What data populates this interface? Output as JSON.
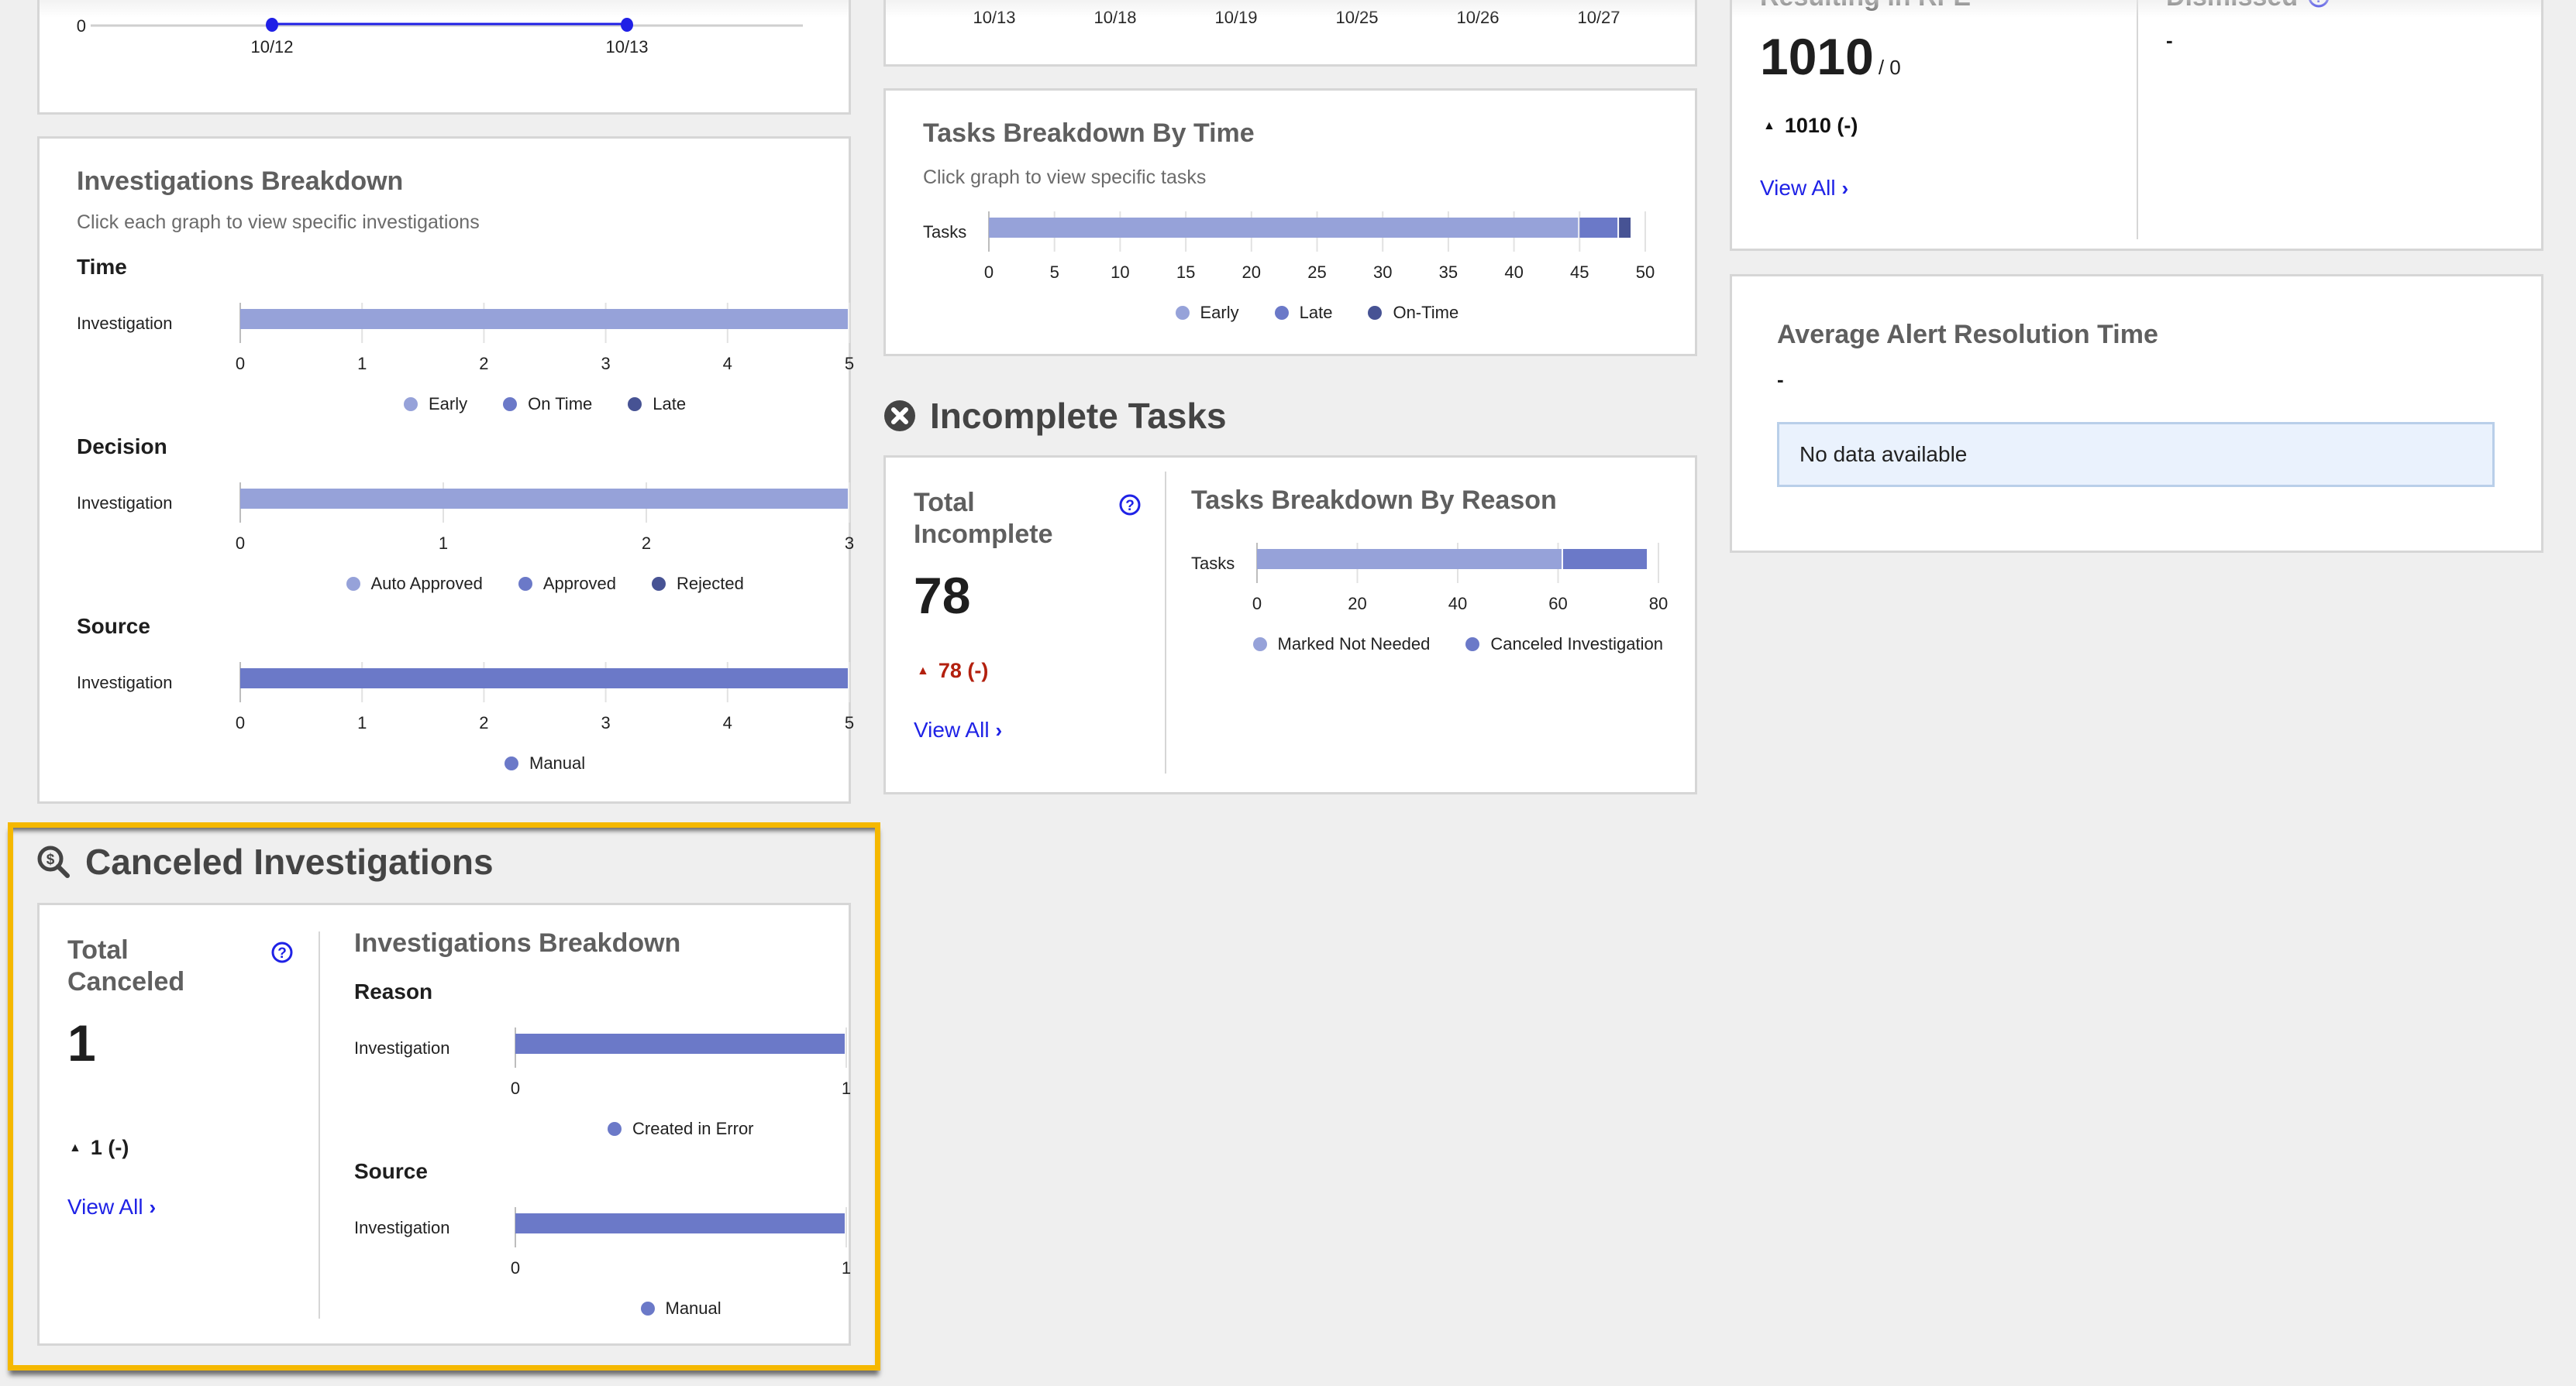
{
  "colors": {
    "light": "#96a2d9",
    "mid": "#6b79c8",
    "dark": "#475394",
    "link": "#1f22e6",
    "negative": "#b3200e",
    "highlight": "#f5b800",
    "line": "#2020e6"
  },
  "top_line_chart": {
    "y_tick": "0",
    "x_labels": [
      "10/12",
      "10/13"
    ]
  },
  "top_middle_axis": {
    "x_labels": [
      "10/13",
      "10/18",
      "10/19",
      "10/25",
      "10/26",
      "10/27"
    ]
  },
  "rfe_panel": {
    "label": "Resulting in RFE",
    "value": "1010",
    "suffix": "/ 0",
    "delta": "1010 (-)",
    "view_all": "View All"
  },
  "dismissed_panel": {
    "label": "Dismissed",
    "value": "-"
  },
  "investigations_breakdown": {
    "title": "Investigations Breakdown",
    "subtitle": "Click each graph to view specific investigations"
  },
  "tasks_by_time": {
    "title": "Tasks Breakdown By Time",
    "subtitle": "Click graph to view specific tasks"
  },
  "incomplete_tasks": {
    "heading": "Incomplete Tasks",
    "stat_label_1": "Total",
    "stat_label_2": "Incomplete",
    "value": "78",
    "delta": "78 (-)",
    "view_all": "View All",
    "chart_title": "Tasks Breakdown By Reason"
  },
  "avg_resolution": {
    "title": "Average Alert Resolution Time",
    "value": "-",
    "message": "No data available"
  },
  "canceled_investigations": {
    "heading": "Canceled Investigations",
    "stat_label_1": "Total",
    "stat_label_2": "Canceled",
    "value": "1",
    "delta": "1 (-)",
    "view_all": "View All",
    "chart_title": "Investigations Breakdown"
  },
  "chart_data": [
    {
      "id": "inv_time",
      "type": "bar",
      "orientation": "horizontal-stacked",
      "title": "Time",
      "categories": [
        "Investigation"
      ],
      "series": [
        {
          "name": "Early",
          "values": [
            5
          ],
          "color": "light"
        },
        {
          "name": "On Time",
          "values": [
            0
          ],
          "color": "mid"
        },
        {
          "name": "Late",
          "values": [
            0
          ],
          "color": "dark"
        }
      ],
      "xlim": [
        0,
        5
      ],
      "ticks": [
        0,
        1,
        2,
        3,
        4,
        5
      ],
      "legend": "bottom"
    },
    {
      "id": "inv_decision",
      "type": "bar",
      "orientation": "horizontal-stacked",
      "title": "Decision",
      "categories": [
        "Investigation"
      ],
      "series": [
        {
          "name": "Auto Approved",
          "values": [
            3
          ],
          "color": "light"
        },
        {
          "name": "Approved",
          "values": [
            0
          ],
          "color": "mid"
        },
        {
          "name": "Rejected",
          "values": [
            0
          ],
          "color": "dark"
        }
      ],
      "xlim": [
        0,
        3
      ],
      "ticks": [
        0,
        1,
        2,
        3
      ],
      "legend": "bottom"
    },
    {
      "id": "inv_source",
      "type": "bar",
      "orientation": "horizontal-stacked",
      "title": "Source",
      "categories": [
        "Investigation"
      ],
      "series": [
        {
          "name": "Manual",
          "values": [
            5
          ],
          "color": "mid"
        }
      ],
      "xlim": [
        0,
        5
      ],
      "ticks": [
        0,
        1,
        2,
        3,
        4,
        5
      ],
      "legend": "bottom"
    },
    {
      "id": "tasks_time",
      "type": "bar",
      "orientation": "horizontal-stacked",
      "title": "Tasks Breakdown By Time",
      "categories": [
        "Tasks"
      ],
      "series": [
        {
          "name": "Early",
          "values": [
            45
          ],
          "color": "light"
        },
        {
          "name": "Late",
          "values": [
            3
          ],
          "color": "mid"
        },
        {
          "name": "On-Time",
          "values": [
            1
          ],
          "color": "dark"
        }
      ],
      "xlim": [
        0,
        50
      ],
      "ticks": [
        0,
        5,
        10,
        15,
        20,
        25,
        30,
        35,
        40,
        45,
        50
      ],
      "legend": "bottom"
    },
    {
      "id": "tasks_reason",
      "type": "bar",
      "orientation": "horizontal-stacked",
      "title": "Tasks Breakdown By Reason",
      "categories": [
        "Tasks"
      ],
      "series": [
        {
          "name": "Marked Not Needed",
          "values": [
            61
          ],
          "color": "light"
        },
        {
          "name": "Canceled Investigation",
          "values": [
            17
          ],
          "color": "mid"
        }
      ],
      "xlim": [
        0,
        80
      ],
      "ticks": [
        0,
        20,
        40,
        60,
        80
      ],
      "legend": "bottom"
    },
    {
      "id": "canceled_reason",
      "type": "bar",
      "orientation": "horizontal-stacked",
      "title": "Reason",
      "categories": [
        "Investigation"
      ],
      "series": [
        {
          "name": "Created in Error",
          "values": [
            1
          ],
          "color": "mid"
        }
      ],
      "xlim": [
        0,
        1
      ],
      "ticks": [
        0,
        1
      ],
      "legend": "bottom"
    },
    {
      "id": "canceled_source",
      "type": "bar",
      "orientation": "horizontal-stacked",
      "title": "Source",
      "categories": [
        "Investigation"
      ],
      "series": [
        {
          "name": "Manual",
          "values": [
            1
          ],
          "color": "mid"
        }
      ],
      "xlim": [
        0,
        1
      ],
      "ticks": [
        0,
        1
      ],
      "legend": "bottom"
    }
  ]
}
